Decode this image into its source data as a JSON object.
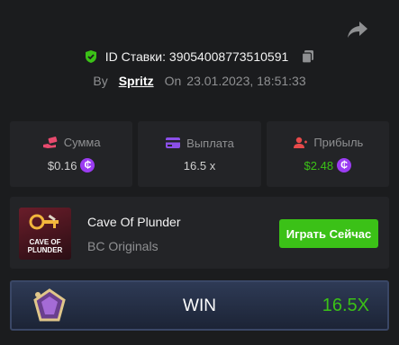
{
  "header": {
    "id_label": "ID Ставки: 39054008773510591",
    "by_label": "By",
    "user": "Spritz",
    "on_label": "On",
    "date": "23.01.2023, 18:51:33"
  },
  "stats": [
    {
      "label": "Сумма",
      "value": "$0.16",
      "icon": "money-hand-icon",
      "icon_color": "#e84a6e"
    },
    {
      "label": "Выплата",
      "value": "16.5 x",
      "icon": "card-icon",
      "icon_color": "#8b4fe8"
    },
    {
      "label": "Прибыль",
      "value": "$2.48",
      "icon": "user-profit-icon",
      "icon_color": "#e84a4a"
    }
  ],
  "game": {
    "thumb_text": "CAVE OF PLUNDER",
    "title": "Cave Of Plunder",
    "provider": "BC Originals",
    "play_label": "Играть Сейчас"
  },
  "result": {
    "label": "WIN",
    "multiplier": "16.5X"
  },
  "colors": {
    "accent_green": "#3bc117",
    "coin_purple": "#9b3cf2",
    "background": "#1b1c1e",
    "card": "#232427"
  }
}
